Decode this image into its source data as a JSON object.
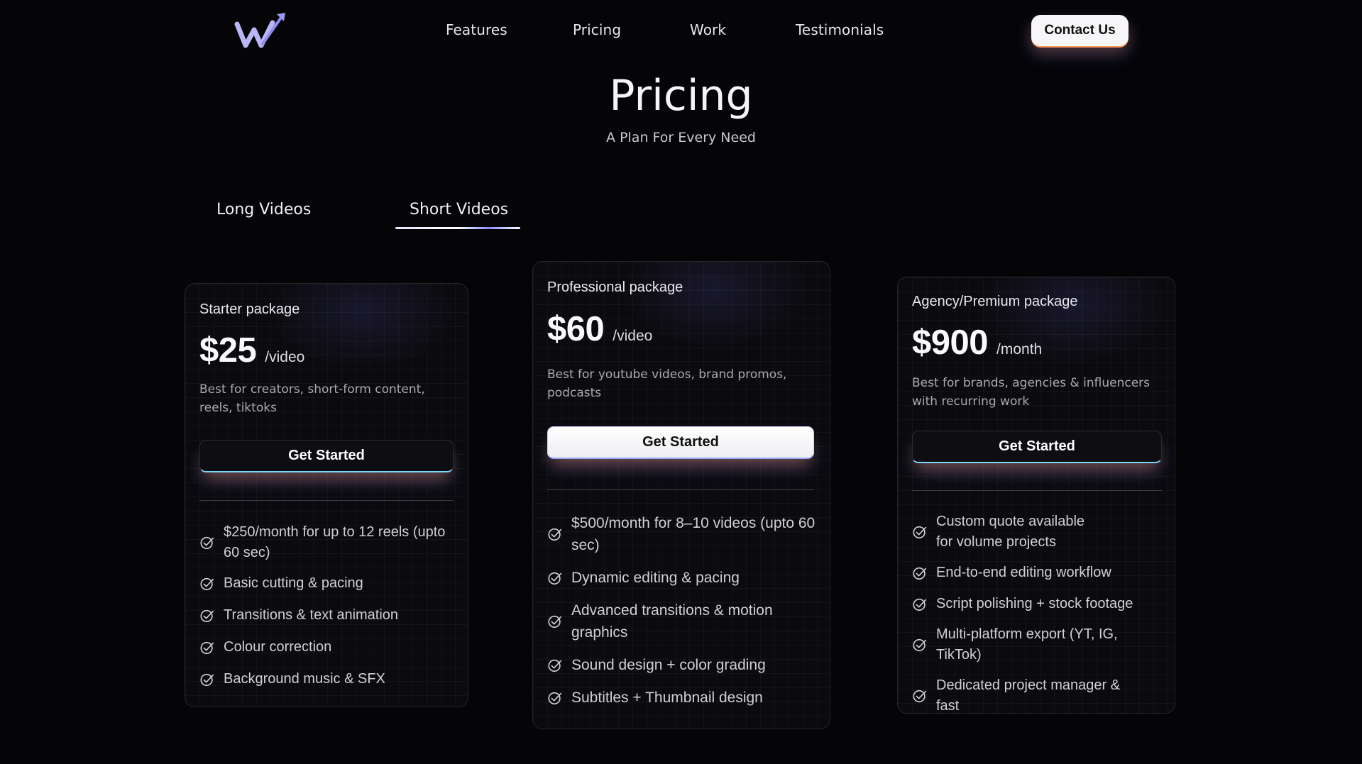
{
  "nav": {
    "links": [
      "Features",
      "Pricing",
      "Work",
      "Testimonials"
    ],
    "contact_label": "Contact Us",
    "logo_icon": "w-arrow-logo-icon"
  },
  "hero": {
    "title": "Pricing",
    "subtitle": "A Plan For Every Need"
  },
  "tabs": [
    {
      "label": "Long Videos",
      "active": false
    },
    {
      "label": "Short Videos",
      "active": true
    }
  ],
  "plans": [
    {
      "name": "Starter package",
      "price": "$25",
      "unit": "/video",
      "description": "Best for creators, short-form content, reels, tiktoks",
      "cta": "Get Started",
      "cta_style": "dark",
      "features": [
        "$250/month for up to 12 reels (upto 60 sec)",
        "Basic cutting & pacing",
        "Transitions & text animation",
        "Colour correction",
        "Background music & SFX"
      ]
    },
    {
      "name": "Professional package",
      "price": "$60",
      "unit": "/video",
      "description": "Best for youtube videos, brand promos, podcasts",
      "cta": "Get Started",
      "cta_style": "light",
      "features": [
        "$500/month for 8–10 videos (upto 60 sec)",
        "Dynamic editing & pacing",
        "Advanced transitions & motion graphics",
        "Sound design + color grading",
        "Subtitles + Thumbnail design"
      ]
    },
    {
      "name": "Agency/Premium package",
      "price": "$900",
      "unit": "/month",
      "description": "Best for brands, agencies & influencers with recurring work",
      "cta": "Get Started",
      "cta_style": "dark",
      "features": [
        "Custom quote available for volume projects",
        "End-to-end editing workflow",
        "Script polishing + stock footage",
        "Multi-platform export (YT, IG, TikTok)",
        "Dedicated project manager & fast"
      ]
    }
  ],
  "colors": {
    "background": "#050508",
    "card_border": "#24242b",
    "accent_blue": "#7ad6ff",
    "accent_orange": "#ff9a5c",
    "logo": "#b8b5f5"
  }
}
